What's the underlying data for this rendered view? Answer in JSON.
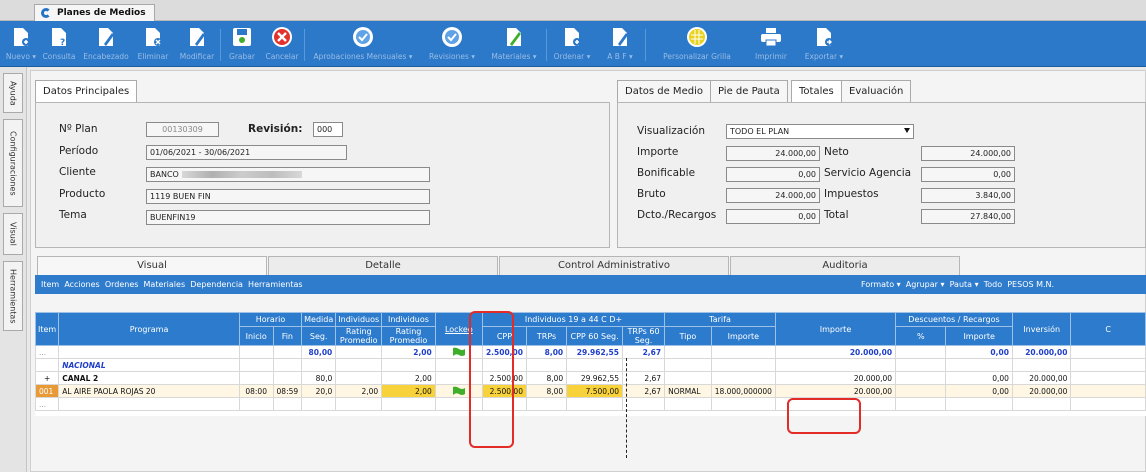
{
  "window": {
    "tab_title": "Planes de Medios"
  },
  "toolbar": {
    "buttons": [
      {
        "label": "Nuevo ▾",
        "icon": "new-document-icon",
        "active": false
      },
      {
        "label": "Consulta",
        "icon": "query-document-icon",
        "active": false
      },
      {
        "label": "Encabezado",
        "icon": "header-edit-icon",
        "active": false
      },
      {
        "label": "Eliminar",
        "icon": "delete-document-icon",
        "active": false
      },
      {
        "label": "Modificar",
        "icon": "edit-document-icon",
        "active": false
      },
      {
        "label": "Grabar",
        "icon": "save-icon",
        "active": true
      },
      {
        "label": "Cancelar",
        "icon": "cancel-icon",
        "active": true
      },
      {
        "label": "Aprobaciones Mensuales ▾",
        "icon": "approve-monthly-icon",
        "active": false
      },
      {
        "label": "Revisiones ▾",
        "icon": "review-icon",
        "active": false
      },
      {
        "label": "Materiales ▾",
        "icon": "materials-icon",
        "active": true
      },
      {
        "label": "Ordenar ▾",
        "icon": "order-icon",
        "active": false
      },
      {
        "label": "A B F ▾",
        "icon": "abf-icon",
        "active": false
      },
      {
        "label": "Personalizar Grilla",
        "icon": "customize-grid-icon",
        "active": true
      },
      {
        "label": "Imprimir",
        "icon": "print-icon",
        "active": false
      },
      {
        "label": "Exportar ▾",
        "icon": "export-icon",
        "active": false
      }
    ]
  },
  "sidebar": {
    "tabs": [
      "Ayuda",
      "Configuraciones",
      "Visual",
      "Herramientas"
    ]
  },
  "datos_principales": {
    "tab": "Datos Principales",
    "nplan_label": "Nº Plan",
    "nplan": "00130309",
    "revision_label": "Revisión:",
    "revision": "000",
    "periodo_label": "Período",
    "periodo": "01/06/2021 - 30/06/2021",
    "cliente_label": "Cliente",
    "cliente": "BANCO",
    "producto_label": "Producto",
    "producto": "1119 BUEN FIN",
    "tema_label": "Tema",
    "tema": "BUENFIN19"
  },
  "totales": {
    "tabs": [
      "Datos de Medio",
      "Pie de Pauta",
      "Totales",
      "Evaluación"
    ],
    "selected_tab": "Totales",
    "visualizacion_label": "Visualización",
    "visualizacion": "TODO EL PLAN",
    "importe_label": "Importe",
    "importe": "24.000,00",
    "neto_label": "Neto",
    "neto": "24.000,00",
    "bonificable_label": "Bonificable",
    "bonificable": "0,00",
    "servicio_label": "Servicio Agencia",
    "servicio": "0,00",
    "bruto_label": "Bruto",
    "bruto": "24.000,00",
    "impuestos_label": "Impuestos",
    "impuestos": "3.840,00",
    "dcto_label": "Dcto./Recargos",
    "dcto": "0,00",
    "total_label": "Total",
    "total": "27.840,00"
  },
  "bottom_tabs": [
    "Visual",
    "Detalle",
    "Control Administrativo",
    "Auditoria"
  ],
  "menubar": {
    "left": [
      "Item",
      "Acciones",
      "Ordenes",
      "Materiales",
      "Dependencia",
      "Herramientas"
    ],
    "right": [
      "Formato ▾",
      "Agrupar ▾",
      "Pauta ▾",
      "Todo",
      "PESOS M.N."
    ]
  },
  "grid": {
    "group_headers": {
      "horario": "Horario",
      "medida": "Medida",
      "individuos1": "Individuos",
      "individuos2": "Individuos",
      "lockeo": "Lockeo",
      "individuos_rango": "Individuos 19 a 44 C D+",
      "tarifa": "Tarifa",
      "descuentos": "Descuentos / Recargos",
      "inversion": "Inversión",
      "extra": "C"
    },
    "headers": {
      "item": "Item",
      "programa": "Programa",
      "inicio": "Inicio",
      "fin": "Fin",
      "seg": "Seg.",
      "rating1": "Rating Promedio",
      "rating2": "Rating Promedio",
      "cpp": "CPP",
      "trps": "TRPs",
      "cpp60": "CPP 60 Seg.",
      "trps60": "TRPs 60 Seg.",
      "tipo": "Tipo",
      "importe_t": "Importe",
      "importe": "Importe",
      "pct": "%",
      "importe_d": "Importe"
    },
    "rows": [
      {
        "item": "...",
        "programa": "",
        "inicio": "",
        "fin": "",
        "seg": "80,00",
        "rating1": "",
        "rating2": "2,00",
        "lock": true,
        "cpp": "2.500,00",
        "trps": "8,00",
        "cpp60": "29.962,55",
        "trps60": "2,67",
        "tipo": "",
        "importe_t": "",
        "importe": "20.000,00",
        "pct": "",
        "importe_d": "0,00",
        "inversion": "20.000,00"
      },
      {
        "item": "",
        "programa": "NACIONAL",
        "inicio": "",
        "fin": "",
        "seg": "",
        "rating1": "",
        "rating2": "",
        "lock": false,
        "cpp": "",
        "trps": "",
        "cpp60": "",
        "trps60": "",
        "tipo": "",
        "importe_t": "",
        "importe": "",
        "pct": "",
        "importe_d": "",
        "inversion": ""
      },
      {
        "item": "+",
        "programa": "CANAL 2",
        "inicio": "",
        "fin": "",
        "seg": "80,0",
        "rating1": "",
        "rating2": "2,00",
        "lock": false,
        "cpp": "2.500,00",
        "trps": "8,00",
        "cpp60": "29.962,55",
        "trps60": "2,67",
        "tipo": "",
        "importe_t": "",
        "importe": "20.000,00",
        "pct": "",
        "importe_d": "0,00",
        "inversion": "20.000,00"
      },
      {
        "item": "001",
        "programa": "AL AIRE PAOLA ROJAS 20",
        "inicio": "08:00",
        "fin": "08:59",
        "seg": "20,0",
        "rating1": "2,00",
        "rating2": "2,00",
        "lock": true,
        "cpp": "2.500,00",
        "trps": "8,00",
        "cpp60": "7.500,00",
        "trps60": "2,67",
        "tipo": "NORMAL",
        "importe_t": "18.000,000000",
        "importe": "20.000,00",
        "pct": "",
        "importe_d": "0,00",
        "inversion": "20.000,00"
      },
      {
        "item": "...",
        "programa": "",
        "inicio": "",
        "fin": "",
        "seg": "",
        "rating1": "",
        "rating2": "",
        "lock": false,
        "cpp": "",
        "trps": "",
        "cpp60": "",
        "trps60": "",
        "tipo": "",
        "importe_t": "",
        "importe": "",
        "pct": "",
        "importe_d": "",
        "inversion": ""
      }
    ]
  },
  "colors": {
    "toolbar": "#2c78c9",
    "header": "#2d7bcc",
    "highlight": "#e32b27",
    "yellow": "#f8d23b",
    "flag": "#3fae2a"
  }
}
